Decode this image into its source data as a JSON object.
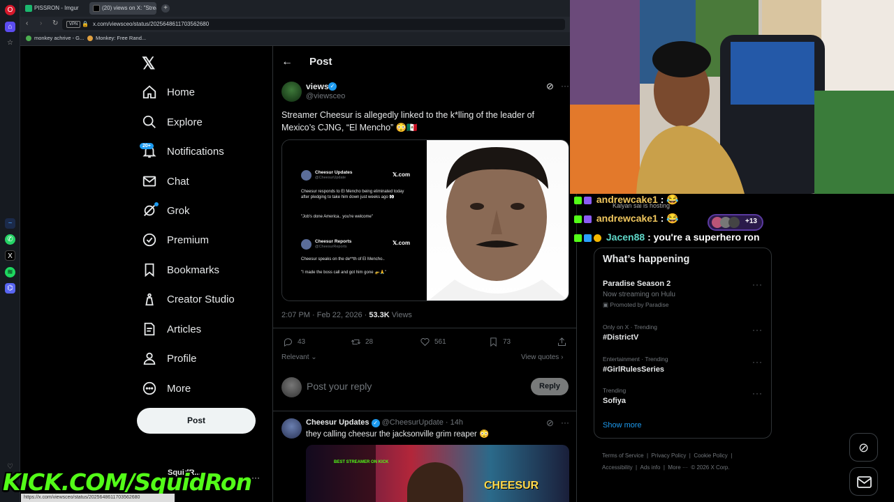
{
  "browser": {
    "tabs": [
      {
        "title": "PISSRON - Imgur"
      },
      {
        "title": "(20) views on X: \"Streamer..."
      }
    ],
    "url": "x.com/viewsceo/status/2025648611703562680",
    "vpn_label": "VPN",
    "bookmarks": [
      "monkey achrive - G...",
      "Monkey: Free Rand..."
    ]
  },
  "nav": {
    "items": [
      {
        "label": "Home",
        "icon": "home-icon"
      },
      {
        "label": "Explore",
        "icon": "search-icon"
      },
      {
        "label": "Notifications",
        "icon": "bell-icon",
        "badge": "20+"
      },
      {
        "label": "Chat",
        "icon": "mail-icon"
      },
      {
        "label": "Grok",
        "icon": "grok-icon"
      },
      {
        "label": "Premium",
        "icon": "verified-icon"
      },
      {
        "label": "Bookmarks",
        "icon": "bookmark-icon"
      },
      {
        "label": "Creator Studio",
        "icon": "creator-icon"
      },
      {
        "label": "Articles",
        "icon": "article-icon"
      },
      {
        "label": "Profile",
        "icon": "person-icon"
      },
      {
        "label": "More",
        "icon": "more-circle-icon"
      }
    ],
    "post_button": "Post",
    "account_name": "SquidR..."
  },
  "overlay": {
    "kick_text": "KICK.COM/SquidRon"
  },
  "post": {
    "header_title": "Post",
    "author_name": "views",
    "author_handle": "@viewsceo",
    "text": "Streamer Cheesur is allegedly linked to the k*lling of the leader of Mexico’s CJNG, “El Mencho” 😳🇲🇽",
    "timestamp": "2:07 PM · Feb 22, 2026 ·",
    "views_count": "53.3K",
    "views_label": "Views",
    "stats": {
      "replies": "43",
      "reposts": "28",
      "likes": "561",
      "bookmarks": "73"
    },
    "sort_label": "Relevant",
    "view_quotes": "View quotes",
    "reply_placeholder": "Post your reply",
    "reply_button": "Reply",
    "embedded": {
      "tweet1": {
        "name": "Cheesur Updates",
        "handle": "@CheesurUpdate",
        "site": "𝕏.com",
        "text": "Cheesur responds to El Mencho being eliminated today after pledging to take him down just weeks ago 👀",
        "quote": "\"Job's done America.. you're welcome\""
      },
      "tweet2": {
        "name": "Cheesur Reports",
        "handle": "@CheesurReports",
        "site": "𝕏.com",
        "text": "Cheesur speaks on the de**th of El Mencho..",
        "quote": "\"I made the boss call and got him gone 🚁🙏\""
      }
    }
  },
  "reply": {
    "author_name": "Cheesur Updates",
    "author_handle": "@CheesurUpdate",
    "age": "· 14h",
    "text": "they calling cheesur the jacksonville grim reaper 😳",
    "media_text": "CHEESUR",
    "media_badge": "BEST STREAMER ON KICK"
  },
  "chat": [
    {
      "user": "andrewcake1",
      "message": ":",
      "emote": "😂",
      "color": "#f0c75e"
    },
    {
      "user": "andrewcake1",
      "message": ":",
      "emote": "😂",
      "color": "#f0c75e",
      "plus": "+13"
    },
    {
      "user": "Jacen88",
      "message": ": you're a superhero ron",
      "color": "#5fd7c8"
    }
  ],
  "chat_host_notice": "Kalyan sai is hosting",
  "happening": {
    "title": "What’s happening",
    "trends": [
      {
        "top": "Paradise Season 2",
        "sub": "Now streaming on Hulu",
        "promo": "Promoted by Paradise"
      },
      {
        "top": "Only on X · Trending",
        "name": "#DistrictV"
      },
      {
        "top": "Entertainment · Trending",
        "name": "#GirlRulesSeries"
      },
      {
        "top": "Trending",
        "name": "Sofiya"
      }
    ],
    "show_more": "Show more"
  },
  "footer_links": [
    "Terms of Service",
    "Privacy Policy",
    "Cookie Policy",
    "Accessibility",
    "Ads info",
    "More ···",
    "© 2026 X Corp."
  ],
  "colors": {
    "accent": "#1d9bf0",
    "kick_green": "#53fc18",
    "bg": "#000000",
    "text": "#e7e9ea",
    "muted": "#71767b"
  }
}
